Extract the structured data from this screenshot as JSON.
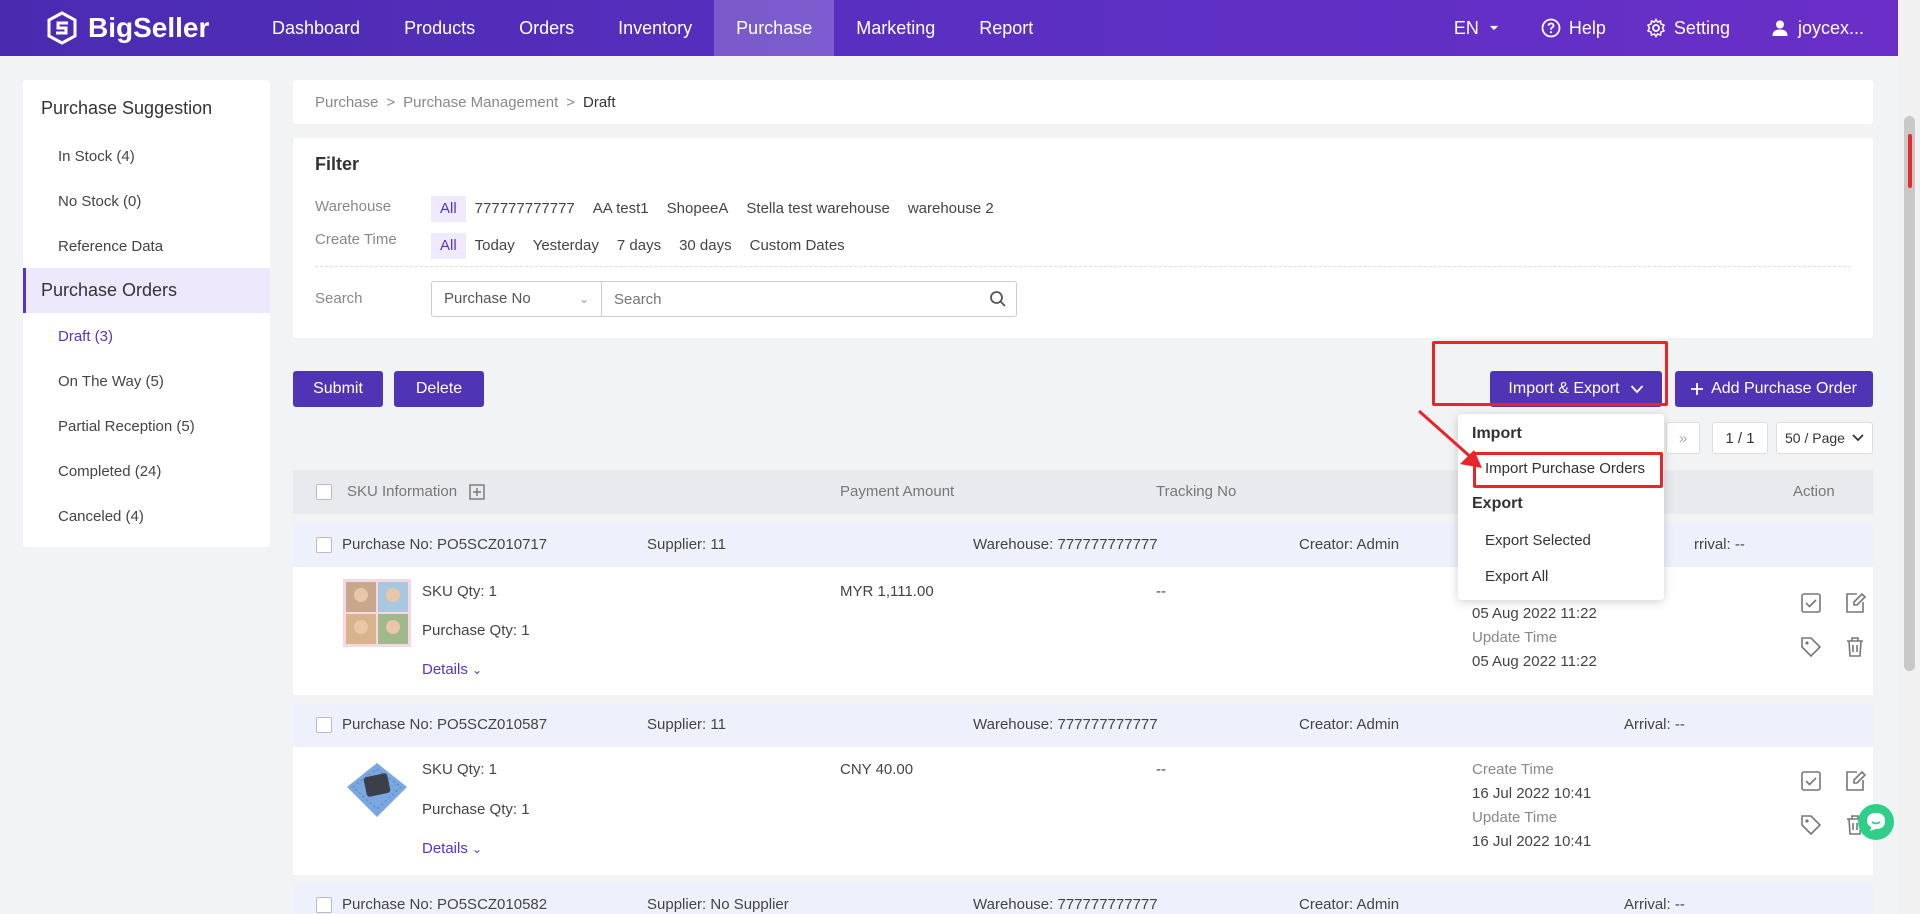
{
  "app": {
    "logo_text": "BigSeller"
  },
  "nav": {
    "items": [
      "Dashboard",
      "Products",
      "Orders",
      "Inventory",
      "Purchase",
      "Marketing",
      "Report"
    ],
    "active": "Purchase",
    "lang": "EN",
    "help": "Help",
    "setting": "Setting",
    "user": "joycex..."
  },
  "sidebar": {
    "suggestion_title": "Purchase Suggestion",
    "suggestion_items": [
      "In Stock (4)",
      "No Stock (0)",
      "Reference Data"
    ],
    "orders_title": "Purchase Orders",
    "order_items": [
      "Draft (3)",
      "On The Way (5)",
      "Partial Reception (5)",
      "Completed (24)",
      "Canceled (4)"
    ]
  },
  "breadcrumb": {
    "items": [
      "Purchase",
      "Purchase Management",
      "Draft"
    ],
    "separator": ">"
  },
  "filter": {
    "title": "Filter",
    "warehouse_label": "Warehouse",
    "warehouse_options": [
      "All",
      "777777777777",
      "AA test1",
      "ShopeeA",
      "Stella test warehouse",
      "warehouse 2"
    ],
    "time_label": "Create Time",
    "time_options": [
      "All",
      "Today",
      "Yesterday",
      "7 days",
      "30 days",
      "Custom Dates"
    ],
    "search_label": "Search",
    "search_type": "Purchase No",
    "search_placeholder": "Search"
  },
  "actions": {
    "submit": "Submit",
    "delete": "Delete",
    "import_export": "Import & Export",
    "add_order": "Add Purchase Order"
  },
  "dropdown": {
    "import_head": "Import",
    "import_item": "Import Purchase Orders",
    "export_head": "Export",
    "export_selected": "Export Selected",
    "export_all": "Export All"
  },
  "pager": {
    "next_icon": "»",
    "page": "1 / 1",
    "per_page": "50 / Page"
  },
  "table": {
    "headers": {
      "sku": "SKU Information",
      "payment": "Payment Amount",
      "tracking": "Tracking No",
      "action": "Action"
    },
    "rows": [
      {
        "purchase_no": "Purchase No: PO5SCZ010717",
        "supplier": "Supplier: 11",
        "warehouse": "Warehouse: 777777777777",
        "creator": "Creator: Admin",
        "arrival": "rrival: --",
        "sku_qty": "SKU Qty: 1",
        "purchase_qty": "Purchase Qty: 1",
        "details": "Details",
        "amount": "MYR 1,111.00",
        "tracking": "--",
        "create_label": "",
        "create_time": "05 Aug 2022 11:22",
        "update_label": "Update Time",
        "update_time": "05 Aug 2022 11:22"
      },
      {
        "purchase_no": "Purchase No: PO5SCZ010587",
        "supplier": "Supplier: 11",
        "warehouse": "Warehouse: 777777777777",
        "creator": "Creator: Admin",
        "arrival": "Arrival: --",
        "sku_qty": "SKU Qty: 1",
        "purchase_qty": "Purchase Qty: 1",
        "details": "Details",
        "amount": "CNY 40.00",
        "tracking": "--",
        "create_label": "Create Time",
        "create_time": "16 Jul 2022 10:41",
        "update_label": "Update Time",
        "update_time": "16 Jul 2022 10:41"
      },
      {
        "purchase_no": "Purchase No: PO5SCZ010582",
        "supplier": "Supplier: No Supplier",
        "warehouse": "Warehouse: 777777777777",
        "creator": "Creator: Admin",
        "arrival": "Arrival: --"
      }
    ]
  },
  "colors": {
    "brand": "#5634c4",
    "nav": "#5a2fc2",
    "highlight": "#e8262a",
    "chat": "#2fcf8a"
  }
}
